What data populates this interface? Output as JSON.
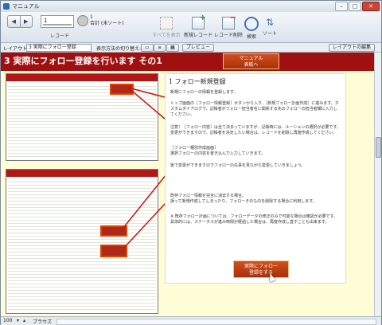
{
  "window": {
    "title": "マニュアル",
    "minimize": "–",
    "maximize": "□",
    "close": "✕"
  },
  "toolbar": {
    "record_value": "1",
    "record_count": "1",
    "record_total": "合計 (未ソート)",
    "record_label": "レコード",
    "show_all": "すべてを表示",
    "new_record": "新規レコード",
    "delete_record": "レコード削除",
    "find": "検索",
    "sort": "ソート"
  },
  "layoutbar": {
    "layout_label": "レイアウト:",
    "layout_value": "3 実際にフォロー登録",
    "view_as_label": "表示方法の切り替え:",
    "preview": "プレビュー",
    "edit_layout": "レイアウトの編集"
  },
  "header": {
    "title": "3  実際にフォロー登録を行います  その1",
    "manual_button": "マニュアル\n表紙へ"
  },
  "doc": {
    "title": "1  フォロー新規登録",
    "p1": "新規にフォローの情報を登録します。",
    "p2": "トップ画面の［フォロー情報登録］ボタンから入り、［新規フォロー計画作成］に進みます。カスタムダイアログで、記帳者がフォロー担当者名に関係する先のフォローの担当者欄に入力してください。",
    "p3": "注意！［フォロー内容］は全て決まっていますが、記帳時には、ルーションの選択が必要です。変更ができますので、記帳者を決定したい場合は、レコードを削除し再度作成してください。",
    "p4": "［フォロー種別作成画面］\n選択フォローの内容を書き込んで入力していきます。",
    "p5": "後で変更ができますのでフォローの先事を見ながら変更していきましょう。",
    "p6": "既存フォロー情報を完全に消去する場合、\n誤って新規作成してしまったり、フォローそのものを削除する場合に利用します。",
    "p7": "※ 既存フォロー計画については、フォローデータの修正のみで可能な場合は確認が必要です。具体的には、ステータスが進み時間が経過した場合は、再度作成し直すことも出来ます。"
  },
  "follow_button": "実際にフォロー\n登録をする",
  "status": {
    "zoom": "100",
    "mode": "ブラウズ"
  }
}
